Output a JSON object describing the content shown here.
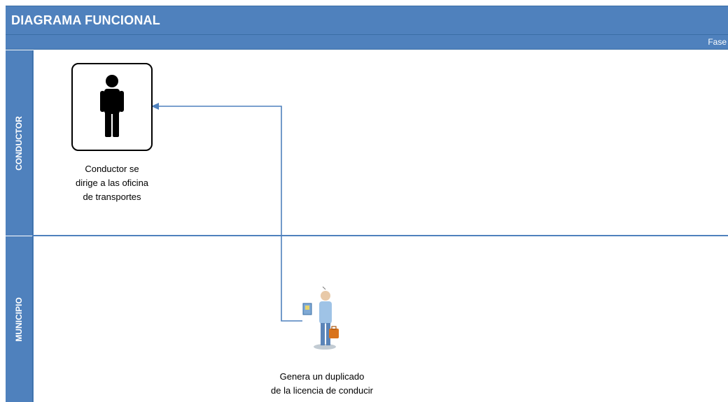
{
  "header": {
    "title": "DIAGRAMA FUNCIONAL"
  },
  "phase": {
    "label": "Fase"
  },
  "lanes": [
    {
      "label": "CONDUCTOR"
    },
    {
      "label": "MUNICIPIO"
    }
  ],
  "nodes": {
    "conductor": {
      "text": "Conductor se\ndirige a las oficina\nde transportes",
      "icon": "person-icon"
    },
    "municipio": {
      "text": "Genera un duplicado\nde la licencia de conducir",
      "icon": "worker-icon"
    }
  },
  "colors": {
    "accent": "#4f81bd",
    "connector": "#4f81bd",
    "text_on_accent": "#ffffff"
  }
}
